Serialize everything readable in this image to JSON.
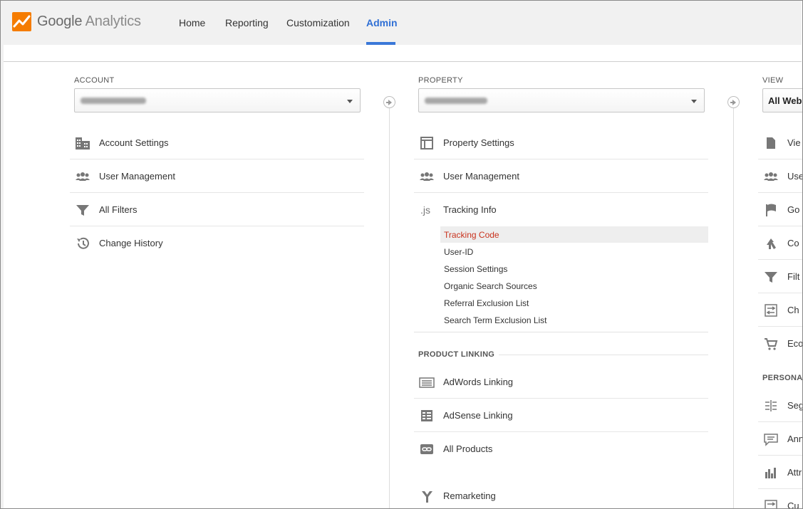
{
  "brand": {
    "name_first": "Google",
    "name_second": "Analytics",
    "logo_color": "#f57c00"
  },
  "nav": {
    "items": [
      {
        "label": "Home"
      },
      {
        "label": "Reporting"
      },
      {
        "label": "Customization"
      },
      {
        "label": "Admin",
        "active": true
      }
    ],
    "active_color": "#2f6fd5"
  },
  "account": {
    "label": "ACCOUNT",
    "items": [
      {
        "label": "Account Settings",
        "icon": "building-icon"
      },
      {
        "label": "User Management",
        "icon": "users-icon"
      },
      {
        "label": "All Filters",
        "icon": "filter-icon"
      },
      {
        "label": "Change History",
        "icon": "history-icon"
      }
    ]
  },
  "property": {
    "label": "PROPERTY",
    "items": [
      {
        "label": "Property Settings",
        "icon": "window-icon"
      },
      {
        "label": "User Management",
        "icon": "users-icon"
      },
      {
        "label": "Tracking Info",
        "icon": "js-icon"
      }
    ],
    "tracking_sub": [
      {
        "label": "Tracking Code",
        "active": true
      },
      {
        "label": "User-ID"
      },
      {
        "label": "Session Settings"
      },
      {
        "label": "Organic Search Sources"
      },
      {
        "label": "Referral Exclusion List"
      },
      {
        "label": "Search Term Exclusion List"
      }
    ],
    "product_linking_label": "PRODUCT LINKING",
    "linking_items": [
      {
        "label": "AdWords Linking",
        "icon": "adwords-icon"
      },
      {
        "label": "AdSense Linking",
        "icon": "adsense-icon"
      },
      {
        "label": "All Products",
        "icon": "link-icon"
      },
      {
        "label": "Remarketing",
        "icon": "remarketing-icon"
      }
    ],
    "active_sub_color": "#c8321d"
  },
  "view": {
    "label": "VIEW",
    "selected": "All Web",
    "items": [
      {
        "label": "Vie",
        "icon": "document-icon"
      },
      {
        "label": "Use",
        "icon": "users-icon"
      },
      {
        "label": "Go",
        "icon": "flag-icon"
      },
      {
        "label": "Co",
        "icon": "merge-icon"
      },
      {
        "label": "Filt",
        "icon": "filter-icon"
      },
      {
        "label": "Ch",
        "icon": "channel-icon"
      },
      {
        "label": "Eco",
        "icon": "cart-icon"
      }
    ],
    "personal_label": "PERSONA",
    "personal_items": [
      {
        "label": "Seg",
        "icon": "segments-icon"
      },
      {
        "label": "Ann",
        "icon": "annotation-icon"
      },
      {
        "label": "Attri",
        "icon": "attribution-icon"
      },
      {
        "label": "Cu",
        "icon": "custom-channel-icon"
      }
    ]
  }
}
